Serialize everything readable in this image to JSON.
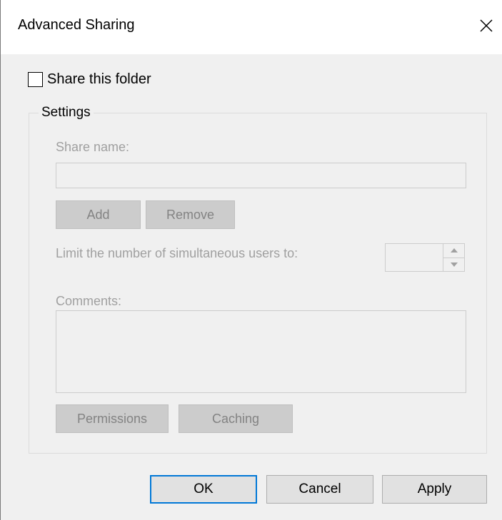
{
  "window": {
    "title": "Advanced Sharing",
    "close_icon": "close-icon"
  },
  "share_checkbox": {
    "label": "Share this folder",
    "checked": false
  },
  "settings": {
    "legend": "Settings",
    "share_name_label": "Share name:",
    "share_name_value": "",
    "add_label": "Add",
    "remove_label": "Remove",
    "limit_label": "Limit the number of simultaneous users to:",
    "limit_value": "",
    "comments_label": "Comments:",
    "comments_value": "",
    "permissions_label": "Permissions",
    "caching_label": "Caching"
  },
  "footer": {
    "ok_label": "OK",
    "cancel_label": "Cancel",
    "apply_label": "Apply"
  },
  "colors": {
    "accent": "#0078d7",
    "disabled_text": "#a0a0a0",
    "dialog_bg": "#f0f0f0"
  }
}
